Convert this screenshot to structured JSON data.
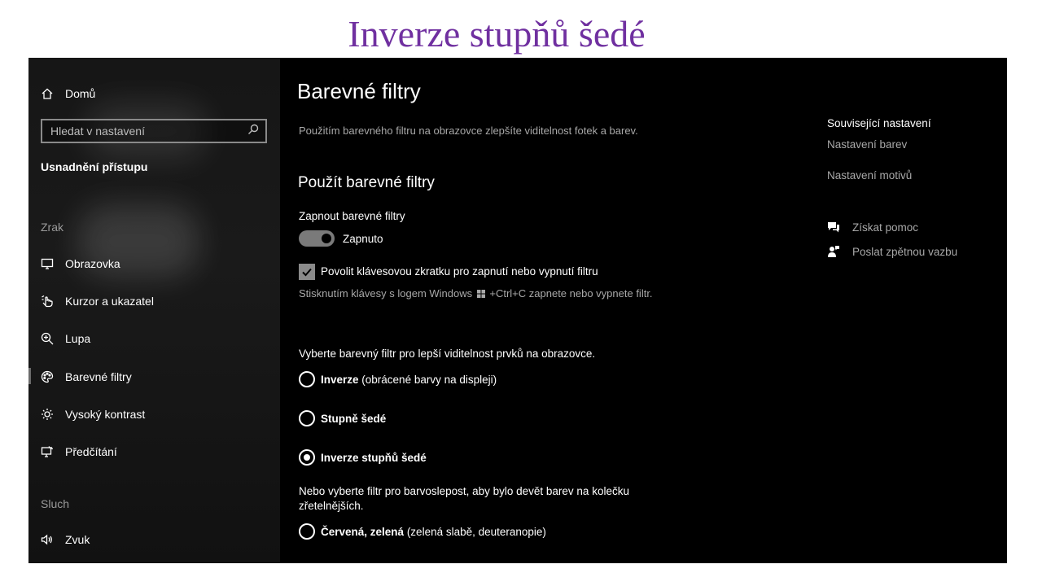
{
  "slide_title": "Inverze stupňů šedé",
  "sidebar": {
    "home_label": "Domů",
    "search_placeholder": "Hledat v nastavení",
    "section_title": "Usnadnění přístupu",
    "category_vision": "Zrak",
    "items": [
      {
        "label": "Obrazovka",
        "icon": "monitor-icon"
      },
      {
        "label": "Kurzor a ukazatel",
        "icon": "cursor-icon"
      },
      {
        "label": "Lupa",
        "icon": "magnifier-icon"
      },
      {
        "label": "Barevné filtry",
        "icon": "palette-icon",
        "selected": true
      },
      {
        "label": "Vysoký kontrast",
        "icon": "sun-icon"
      },
      {
        "label": "Předčítání",
        "icon": "narrator-icon"
      }
    ],
    "category_hearing": "Sluch",
    "hearing_items": [
      {
        "label": "Zvuk",
        "icon": "speaker-icon"
      }
    ]
  },
  "main": {
    "title": "Barevné filtry",
    "description": "Použitím barevného filtru na obrazovce zlepšíte viditelnost fotek a barev.",
    "section_heading": "Použít barevné filtry",
    "toggle_label": "Zapnout barevné filtry",
    "toggle_state": "Zapnuto",
    "toggle_on": true,
    "shortcut_checkbox_label": "Povolit klávesovou zkratku pro zapnutí nebo vypnutí filtru",
    "shortcut_checked": true,
    "shortcut_hint_before": "Stisknutím klávesy s logem Windows",
    "shortcut_hint_after": "+Ctrl+C zapnete nebo vypnete filtr.",
    "choose_filter_label": "Vyberte barevný filtr pro lepší viditelnost prvků na obrazovce.",
    "filters": [
      {
        "name": "Inverze",
        "detail": " (obrácené barvy na displeji)",
        "selected": false
      },
      {
        "name": "Stupně šedé",
        "detail": "",
        "selected": false
      },
      {
        "name": "Inverze stupňů šedé",
        "detail": "",
        "selected": true
      }
    ],
    "colorblind_label": "Nebo vyberte filtr pro barvoslepost, aby bylo devět barev na kolečku zřetelnějších.",
    "colorblind_filters": [
      {
        "name": "Červená, zelená",
        "detail": " (zelená slabě, deuteranopie)",
        "selected": false
      }
    ]
  },
  "related": {
    "heading": "Související nastavení",
    "links": [
      "Nastavení barev",
      "Nastavení motivů"
    ],
    "help_label": "Získat pomoc",
    "feedback_label": "Poslat zpětnou vazbu"
  }
}
